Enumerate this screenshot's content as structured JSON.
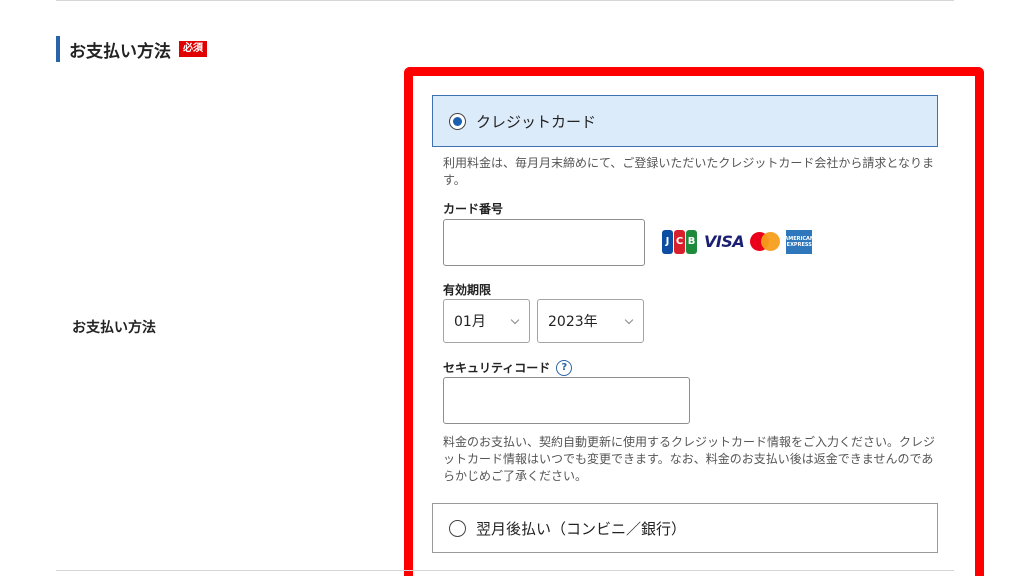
{
  "section": {
    "title": "お支払い方法",
    "required_badge": "必須"
  },
  "row_label": "お支払い方法",
  "credit_option": {
    "label": "クレジットカード",
    "selected": true,
    "description": "利用料金は、毎月月末締めにて、ご登録いただいたクレジットカード会社から請求となります。"
  },
  "card_number": {
    "label": "カード番号",
    "value": "",
    "brands": [
      {
        "name": "JCB",
        "letters": [
          "J",
          "C",
          "B"
        ]
      },
      {
        "name": "VISA",
        "text": "VISA"
      },
      {
        "name": "Mastercard"
      },
      {
        "name": "American Express",
        "lines": [
          "AMERICAN",
          "EXPRESS"
        ]
      }
    ]
  },
  "expiry": {
    "label": "有効期限",
    "month": "01月",
    "year": "2023年"
  },
  "security_code": {
    "label": "セキュリティコード",
    "help_glyph": "?",
    "value": ""
  },
  "payment_note": "料金のお支払い、契約自動更新に使用するクレジットカード情報をご入力ください。クレジットカード情報はいつでも変更できます。なお、料金のお支払い後は返金できませんのであらかじめご了承ください。",
  "deferred_option": {
    "label": "翌月後払い（コンビニ／銀行）",
    "selected": false
  },
  "colors": {
    "accent": "#2a64a8",
    "required_badge": "#e10000",
    "highlight_frame": "#ff0000",
    "selected_bg": "#dcebfa"
  }
}
